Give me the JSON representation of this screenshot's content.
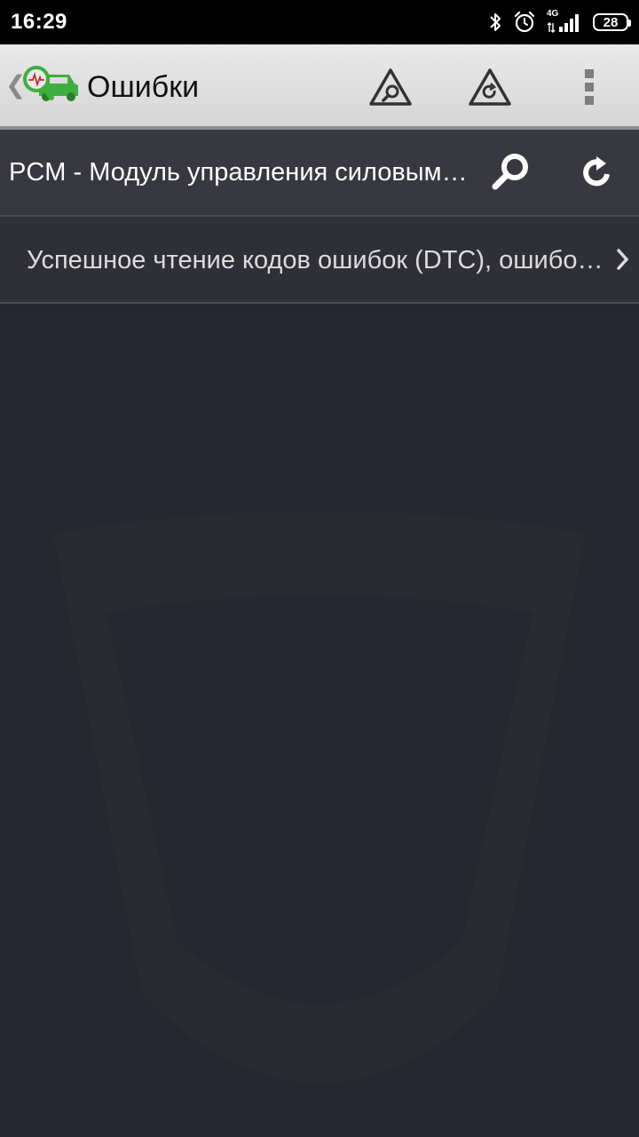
{
  "status_bar": {
    "time": "16:29",
    "network": "4G",
    "battery": "28",
    "icons": [
      "bluetooth-icon",
      "alarm-icon",
      "signal-icon",
      "battery-icon"
    ]
  },
  "toolbar": {
    "title": "Ошибки",
    "icons": [
      "back-chevron-icon",
      "app-logo-icon",
      "warning-search-icon",
      "warning-refresh-icon",
      "overflow-menu-icon"
    ]
  },
  "module": {
    "title": "PCM - Модуль управления силовым агрегатом",
    "icons": [
      "search-icon",
      "refresh-icon"
    ]
  },
  "list": {
    "items": [
      {
        "label": "Успешное чтение кодов ошибок (DTC), ошибок не найдено"
      }
    ]
  },
  "colors": {
    "background": "#262630",
    "toolbar": "#dedede",
    "module_row": "#383840",
    "accent_green": "#3fae3f"
  }
}
